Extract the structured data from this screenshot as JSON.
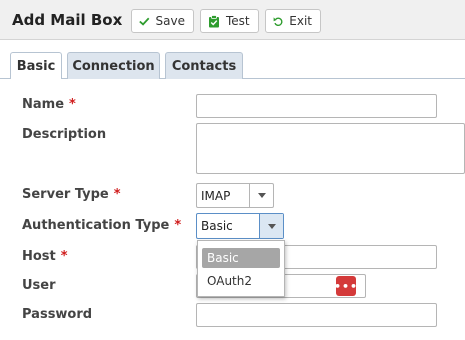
{
  "toolbar": {
    "title": "Add Mail Box",
    "save_label": "Save",
    "test_label": "Test",
    "exit_label": "Exit"
  },
  "tabs": [
    {
      "label": "Basic",
      "active": true
    },
    {
      "label": "Connection",
      "active": false
    },
    {
      "label": "Contacts",
      "active": false
    }
  ],
  "form": {
    "name_label": "Name",
    "description_label": "Description",
    "server_type_label": "Server Type",
    "server_type_value": "IMAP",
    "auth_type_label": "Authentication Type",
    "auth_type_value": "Basic",
    "host_label": "Host",
    "user_label": "User",
    "password_label": "Password",
    "required_marker": "*"
  },
  "auth_dropdown": {
    "options": [
      "Basic",
      "OAuth2"
    ],
    "selected": "Basic"
  },
  "password_icon_text": "•••",
  "colors": {
    "required": "#d01c1c",
    "save_icon": "#2e9c2e",
    "test_icon": "#2e9c2e",
    "exit_icon": "#2e9c2e",
    "password_icon_bg": "#d43a3a"
  }
}
